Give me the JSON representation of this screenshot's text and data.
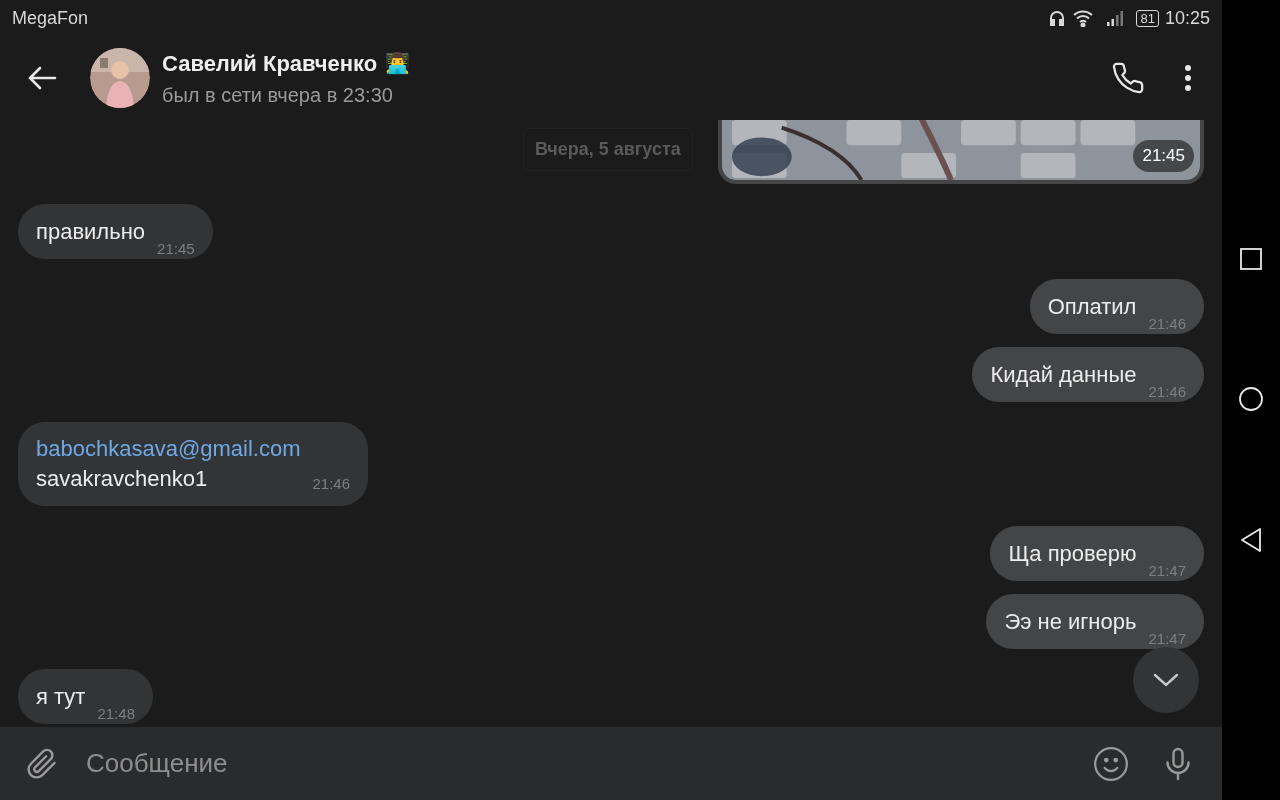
{
  "status_bar": {
    "carrier": "MegaFon",
    "battery": "81",
    "time": "10:25"
  },
  "header": {
    "name": "Савелий Кравченко",
    "name_emoji": "👨‍💻",
    "last_seen": "был в сети вчера в 23:30"
  },
  "date_chip": "Вчера, 5 августа",
  "messages": [
    {
      "outgoing": true,
      "time": "21:45"
    },
    {
      "kind": "text",
      "outgoing": false,
      "text": "правильно",
      "time": "21:45"
    },
    {
      "kind": "text",
      "outgoing": true,
      "text": "Оплатил",
      "time": "21:46"
    },
    {
      "kind": "text",
      "outgoing": true,
      "text": "Кидай данные",
      "time": "21:46"
    },
    {
      "kind": "link",
      "outgoing": false,
      "link": "babochkasava@gmail.com",
      "text": "savakravchenko1",
      "time": "21:46"
    },
    {
      "kind": "text",
      "outgoing": true,
      "text": "Ща проверю",
      "time": "21:47"
    },
    {
      "kind": "text",
      "outgoing": true,
      "text": "Ээ не игнорь",
      "time": "21:47"
    },
    {
      "kind": "text",
      "outgoing": false,
      "text": "я тут",
      "time": "21:48"
    }
  ],
  "composer": {
    "placeholder": "Сообщение"
  }
}
